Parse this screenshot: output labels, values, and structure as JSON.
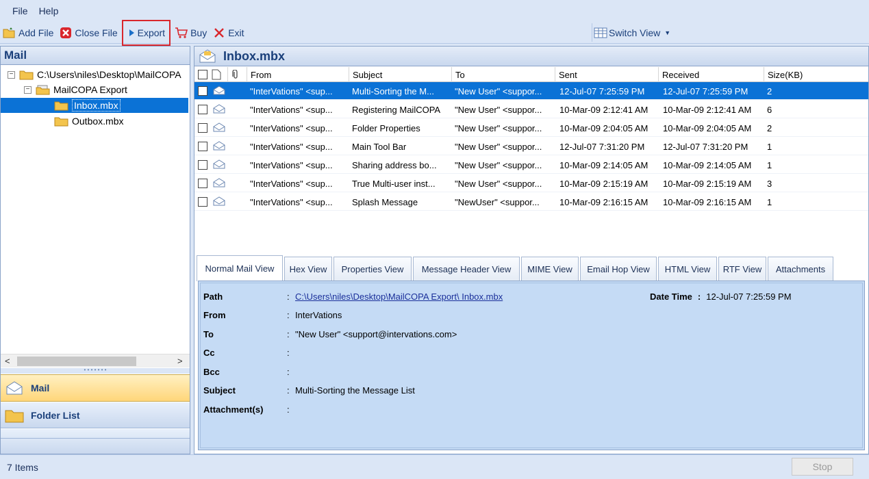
{
  "menu": {
    "file": "File",
    "help": "Help"
  },
  "toolbar": {
    "add_file": "Add File",
    "close_file": "Close File",
    "export": "Export",
    "buy": "Buy",
    "exit": "Exit",
    "switch_view": "Switch View"
  },
  "left": {
    "title": "Mail",
    "tree": {
      "root": "C:\\Users\\niles\\Desktop\\MailCOPA",
      "export_folder": "MailCOPA Export",
      "inbox": "Inbox.mbx",
      "outbox": "Outbox.mbx"
    },
    "nav_mail": "Mail",
    "nav_folder": "Folder List"
  },
  "right": {
    "title": "Inbox.mbx",
    "columns": {
      "from": "From",
      "subject": "Subject",
      "to": "To",
      "sent": "Sent",
      "received": "Received",
      "size": "Size(KB)"
    },
    "rows": [
      {
        "from": "\"InterVations\" <sup...",
        "subject": "Multi-Sorting the M...",
        "to": "\"New User\" <suppor...",
        "sent": "12-Jul-07 7:25:59 PM",
        "received": "12-Jul-07 7:25:59 PM",
        "size": "2"
      },
      {
        "from": "\"InterVations\" <sup...",
        "subject": "Registering MailCOPA",
        "to": "\"New User\" <suppor...",
        "sent": "10-Mar-09 2:12:41 AM",
        "received": "10-Mar-09 2:12:41 AM",
        "size": "6"
      },
      {
        "from": "\"InterVations\" <sup...",
        "subject": "Folder Properties",
        "to": "\"New User\" <suppor...",
        "sent": "10-Mar-09 2:04:05 AM",
        "received": "10-Mar-09 2:04:05 AM",
        "size": "2"
      },
      {
        "from": "\"InterVations\" <sup...",
        "subject": "Main Tool Bar",
        "to": "\"New User\" <suppor...",
        "sent": "12-Jul-07 7:31:20 PM",
        "received": "12-Jul-07 7:31:20 PM",
        "size": "1"
      },
      {
        "from": "\"InterVations\" <sup...",
        "subject": "Sharing address bo...",
        "to": "\"New User\" <suppor...",
        "sent": "10-Mar-09 2:14:05 AM",
        "received": "10-Mar-09 2:14:05 AM",
        "size": "1"
      },
      {
        "from": "\"InterVations\" <sup...",
        "subject": "True Multi-user inst...",
        "to": "\"New User\" <suppor...",
        "sent": "10-Mar-09 2:15:19 AM",
        "received": "10-Mar-09 2:15:19 AM",
        "size": "3"
      },
      {
        "from": "\"InterVations\" <sup...",
        "subject": "Splash Message",
        "to": "\"NewUser\" <suppor...",
        "sent": "10-Mar-09 2:16:15 AM",
        "received": "10-Mar-09 2:16:15 AM",
        "size": "1"
      }
    ],
    "tabs": [
      "Normal Mail View",
      "Hex View",
      "Properties View",
      "Message Header View",
      "MIME View",
      "Email Hop View",
      "HTML View",
      "RTF View",
      "Attachments"
    ],
    "detail": {
      "path_label": "Path",
      "path_value": "C:\\Users\\niles\\Desktop\\MailCOPA Export\\ Inbox.mbx",
      "date_label": "Date Time",
      "date_value": "12-Jul-07 7:25:59 PM",
      "from_label": "From",
      "from_value": "InterVations",
      "to_label": "To",
      "to_value": "\"New User\" <support@intervations.com>",
      "cc_label": "Cc",
      "cc_value": "",
      "bcc_label": "Bcc",
      "bcc_value": "",
      "subject_label": "Subject",
      "subject_value": "Multi-Sorting the Message List",
      "attach_label": "Attachment(s)",
      "attach_value": ""
    }
  },
  "status": {
    "items": "7 Items",
    "stop": "Stop"
  }
}
